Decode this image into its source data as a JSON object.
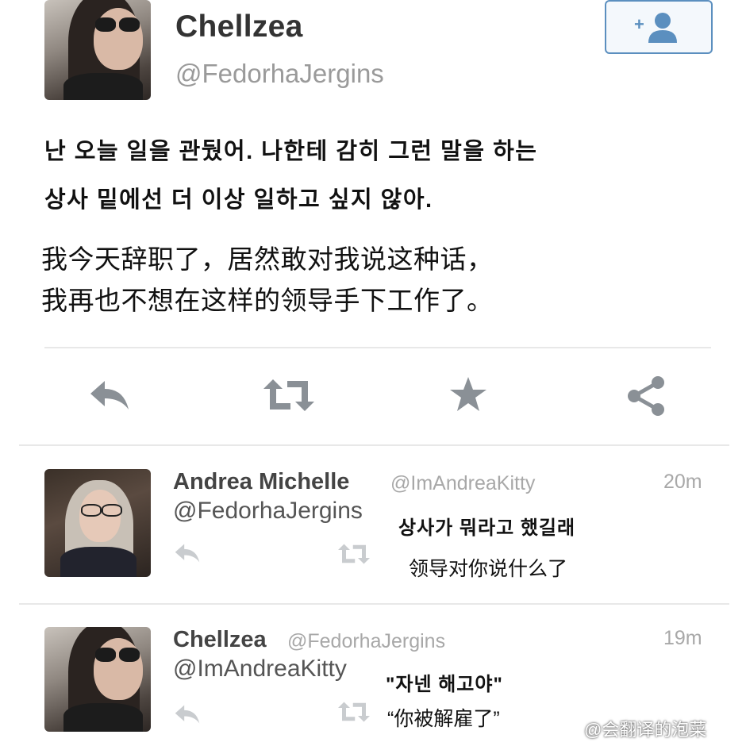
{
  "main_tweet": {
    "display_name": "Chellzea",
    "handle": "@FedorhaJergins",
    "text_ko_line1": "난 오늘 일을 관뒀어. 나한테 감히 그런 말을 하는",
    "text_ko_line2": "상사 밑에선 더 이상 일하고 싶지 않아.",
    "text_zh_line1": "我今天辞职了，居然敢对我说这种话，",
    "text_zh_line2": "我再也不想在这样的领导手下工作了。",
    "actions": [
      "reply-icon",
      "retweet-icon",
      "favorite-icon",
      "share-icon"
    ],
    "follow_icon": "add-user-icon"
  },
  "replies": [
    {
      "display_name": "Andrea Michelle",
      "handle": "@ImAndreaKitty",
      "mention": "@FedorhaJergins",
      "time": "20m",
      "text_ko": "상사가 뭐라고 했길래",
      "text_zh": "领导对你说什么了"
    },
    {
      "display_name": "Chellzea",
      "handle": "@FedorhaJergins",
      "mention": "@ImAndreaKitty",
      "time": "19m",
      "text_ko": "\"자넨 해고야\"",
      "text_zh": "“你被解雇了”"
    }
  ],
  "watermark": "@会翻译的泡菜",
  "colors": {
    "icon_gray": "#8a9096",
    "follow_blue": "#5b8fbf",
    "divider": "#e8e8e8"
  }
}
